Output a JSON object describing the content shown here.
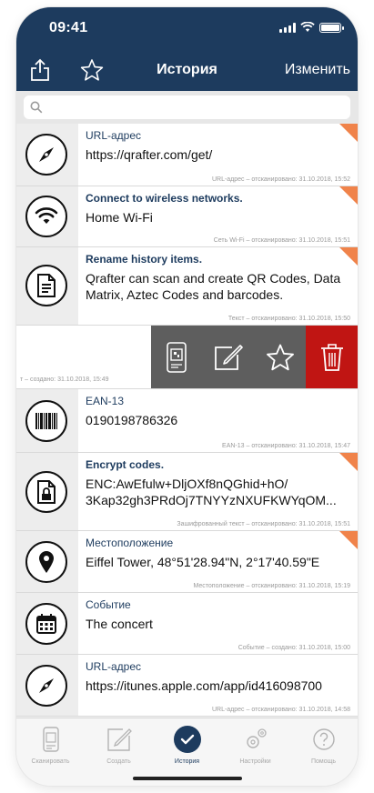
{
  "status_bar": {
    "time": "09:41"
  },
  "nav": {
    "title": "История",
    "edit_label": "Изменить"
  },
  "search": {
    "placeholder": ""
  },
  "rows": [
    {
      "type": "URL-адрес",
      "content": "https://qrafter.com/get/",
      "meta": "URL-адрес – отсканировано: 31.10.2018, 15:52",
      "icon": "compass-icon",
      "ribbon": true
    },
    {
      "type": "Connect to wireless networks.",
      "content": "Home Wi-Fi",
      "meta": "Сеть Wi-Fi – отсканировано: 31.10.2018, 15:51",
      "icon": "wifi-icon",
      "ribbon": true
    },
    {
      "type": "Rename history items.",
      "content": "Qrafter can scan and create QR Codes, Data Matrix, Aztec Codes and barcodes.",
      "meta": "Текст – отсканировано: 31.10.2018, 15:50",
      "icon": "document-icon",
      "ribbon": true
    },
    {
      "type": "EAN-13",
      "content": "0190198786326",
      "meta": "EAN-13 – отсканировано: 31.10.2018, 15:47",
      "icon": "barcode-icon",
      "ribbon": false
    },
    {
      "type": "Encrypt codes.",
      "content": "ENC:AwEfulw+DljOXf8nQGhid+hO/ 3Kap32gh3PRdOj7TNYYzNXUFKWYqOM...",
      "meta": "Зашифрованный текст – отсканировано: 31.10.2018, 15:51",
      "icon": "lock-document-icon",
      "ribbon": true
    },
    {
      "type": "Местоположение",
      "content": "Eiffel Tower, 48°51'28.94\"N, 2°17'40.59\"E",
      "meta": "Местоположение – отсканировано: 31.10.2018, 15:19",
      "icon": "location-pin-icon",
      "ribbon": true
    },
    {
      "type": "Событие",
      "content": "The concert",
      "meta": "Событие – создано: 31.10.2018, 15:00",
      "icon": "calendar-icon",
      "ribbon": false
    },
    {
      "type": "URL-адрес",
      "content": "https://itunes.apple.com/app/id416098700",
      "meta": "URL-адрес – отсканировано: 31.10.2018, 14:58",
      "icon": "compass-icon",
      "ribbon": false
    }
  ],
  "swipe_row": {
    "meta": "т – создано: 31.10.2018, 15:49"
  },
  "swipe_actions": [
    {
      "name": "qr-code-action",
      "icon": "qr-code-icon"
    },
    {
      "name": "edit-action",
      "icon": "edit-icon"
    },
    {
      "name": "favorite-action",
      "icon": "star-icon"
    },
    {
      "name": "delete-action",
      "icon": "trash-icon",
      "color": "#c01513"
    }
  ],
  "tabs": [
    {
      "label": "Сканировать",
      "icon": "scan-icon",
      "active": false
    },
    {
      "label": "Создать",
      "icon": "create-icon",
      "active": false
    },
    {
      "label": "История",
      "icon": "history-check-icon",
      "active": true
    },
    {
      "label": "Настройки",
      "icon": "settings-icon",
      "active": false
    },
    {
      "label": "Помощь",
      "icon": "help-icon",
      "active": false
    }
  ],
  "colors": {
    "nav": "#1d3b5e",
    "ribbon": "#f0834a",
    "delete": "#c01513",
    "action_bg": "#5e5e5e"
  }
}
